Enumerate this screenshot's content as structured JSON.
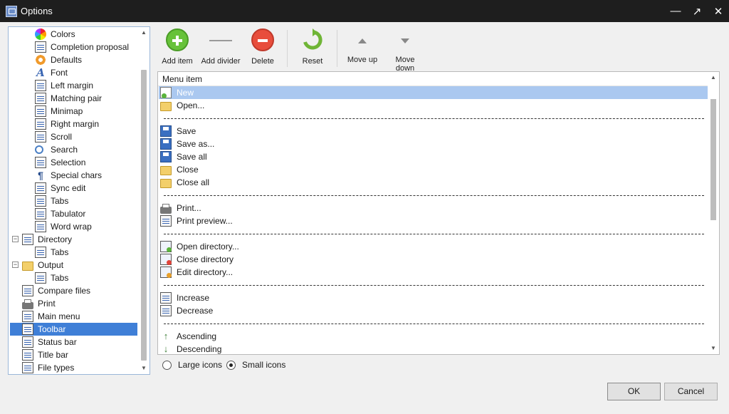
{
  "window": {
    "title": "Options",
    "icon": "app-icon",
    "controls": [
      "minimize-icon",
      "maximize-icon",
      "close-icon"
    ]
  },
  "tree": {
    "items": [
      {
        "label": "Colors",
        "icon": "colors-icon",
        "level": 2
      },
      {
        "label": "Completion proposal",
        "icon": "completion-icon",
        "level": 2
      },
      {
        "label": "Defaults",
        "icon": "defaults-icon",
        "level": 2
      },
      {
        "label": "Font",
        "icon": "font-icon",
        "level": 2
      },
      {
        "label": "Left margin",
        "icon": "left-margin-icon",
        "level": 2
      },
      {
        "label": "Matching pair",
        "icon": "matching-pair-icon",
        "level": 2
      },
      {
        "label": "Minimap",
        "icon": "minimap-icon",
        "level": 2
      },
      {
        "label": "Right margin",
        "icon": "right-margin-icon",
        "level": 2
      },
      {
        "label": "Scroll",
        "icon": "scroll-icon",
        "level": 2
      },
      {
        "label": "Search",
        "icon": "search-icon",
        "level": 2
      },
      {
        "label": "Selection",
        "icon": "selection-icon",
        "level": 2
      },
      {
        "label": "Special chars",
        "icon": "special-chars-icon",
        "level": 2
      },
      {
        "label": "Sync edit",
        "icon": "sync-edit-icon",
        "level": 2
      },
      {
        "label": "Tabs",
        "icon": "tabs-icon",
        "level": 2
      },
      {
        "label": "Tabulator",
        "icon": "tabulator-icon",
        "level": 2
      },
      {
        "label": "Word wrap",
        "icon": "word-wrap-icon",
        "level": 2
      },
      {
        "label": "Directory",
        "icon": "directory-icon",
        "level": 1,
        "expander": "⊟"
      },
      {
        "label": "Tabs",
        "icon": "tabs-icon",
        "level": 2
      },
      {
        "label": "Output",
        "icon": "output-icon",
        "level": 1,
        "expander": "⊟"
      },
      {
        "label": "Tabs",
        "icon": "tabs-icon",
        "level": 2
      },
      {
        "label": "Compare files",
        "icon": "compare-files-icon",
        "level": 1
      },
      {
        "label": "Print",
        "icon": "print-icon",
        "level": 1
      },
      {
        "label": "Main menu",
        "icon": "main-menu-icon",
        "level": 1
      },
      {
        "label": "Toolbar",
        "icon": "toolbar-icon",
        "level": 1,
        "selected": true
      },
      {
        "label": "Status bar",
        "icon": "status-bar-icon",
        "level": 1
      },
      {
        "label": "Title bar",
        "icon": "title-bar-icon",
        "level": 1
      },
      {
        "label": "File types",
        "icon": "file-types-icon",
        "level": 1
      }
    ]
  },
  "toolbar": {
    "add_item": "Add item",
    "add_divider": "Add divider",
    "delete": "Delete",
    "reset": "Reset",
    "move_up": "Move up",
    "move_down": "Move down"
  },
  "list": {
    "header": "Menu item",
    "rows": [
      {
        "type": "item",
        "label": "New",
        "icon": "new-file-icon",
        "selected": true
      },
      {
        "type": "item",
        "label": "Open...",
        "icon": "open-folder-icon"
      },
      {
        "type": "divider"
      },
      {
        "type": "item",
        "label": "Save",
        "icon": "save-icon"
      },
      {
        "type": "item",
        "label": "Save as...",
        "icon": "save-as-icon"
      },
      {
        "type": "item",
        "label": "Save all",
        "icon": "save-all-icon"
      },
      {
        "type": "item",
        "label": "Close",
        "icon": "close-folder-icon"
      },
      {
        "type": "item",
        "label": "Close all",
        "icon": "close-all-icon"
      },
      {
        "type": "divider"
      },
      {
        "type": "item",
        "label": "Print...",
        "icon": "print-icon"
      },
      {
        "type": "item",
        "label": "Print preview...",
        "icon": "print-preview-icon"
      },
      {
        "type": "divider"
      },
      {
        "type": "item",
        "label": "Open directory...",
        "icon": "open-directory-icon"
      },
      {
        "type": "item",
        "label": "Close directory",
        "icon": "close-directory-icon"
      },
      {
        "type": "item",
        "label": "Edit directory...",
        "icon": "edit-directory-icon"
      },
      {
        "type": "divider"
      },
      {
        "type": "item",
        "label": "Increase",
        "icon": "increase-icon"
      },
      {
        "type": "item",
        "label": "Decrease",
        "icon": "decrease-icon"
      },
      {
        "type": "divider"
      },
      {
        "type": "item",
        "label": "Ascending",
        "icon": "sort-ascending-icon"
      },
      {
        "type": "item",
        "label": "Descending",
        "icon": "sort-descending-icon"
      }
    ]
  },
  "icon_size": {
    "options": [
      "Large icons",
      "Small icons"
    ],
    "selected": "Small icons"
  },
  "buttons": {
    "ok": "OK",
    "cancel": "Cancel"
  },
  "colors": {
    "titlebar": "#1e1e1e",
    "selection": "#3f7fd7",
    "list_selection": "#aac8f0"
  }
}
